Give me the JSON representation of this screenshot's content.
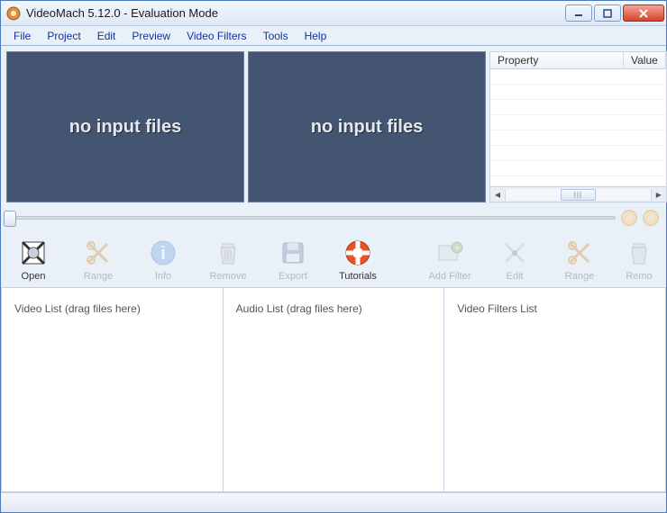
{
  "window": {
    "title": "VideoMach 5.12.0 - Evaluation Mode"
  },
  "menu": {
    "items": [
      "File",
      "Project",
      "Edit",
      "Preview",
      "Video Filters",
      "Tools",
      "Help"
    ]
  },
  "preview": {
    "left_text": "no input files",
    "right_text": "no input files"
  },
  "property_panel": {
    "columns": {
      "property": "Property",
      "value": "Value"
    }
  },
  "toolbar": {
    "open": "Open",
    "range": "Range",
    "info": "Info",
    "remove": "Remove",
    "export": "Export",
    "tutorials": "Tutorials",
    "add_filter": "Add Filter",
    "edit": "Edit",
    "range2": "Range",
    "remove2": "Remo"
  },
  "lists": {
    "video": "Video List (drag files here)",
    "audio": "Audio List (drag files here)",
    "filters": "Video Filters List"
  },
  "colors": {
    "preview_bg": "#435570",
    "accent_blue": "#1033a0",
    "window_border": "#4a7abc"
  }
}
